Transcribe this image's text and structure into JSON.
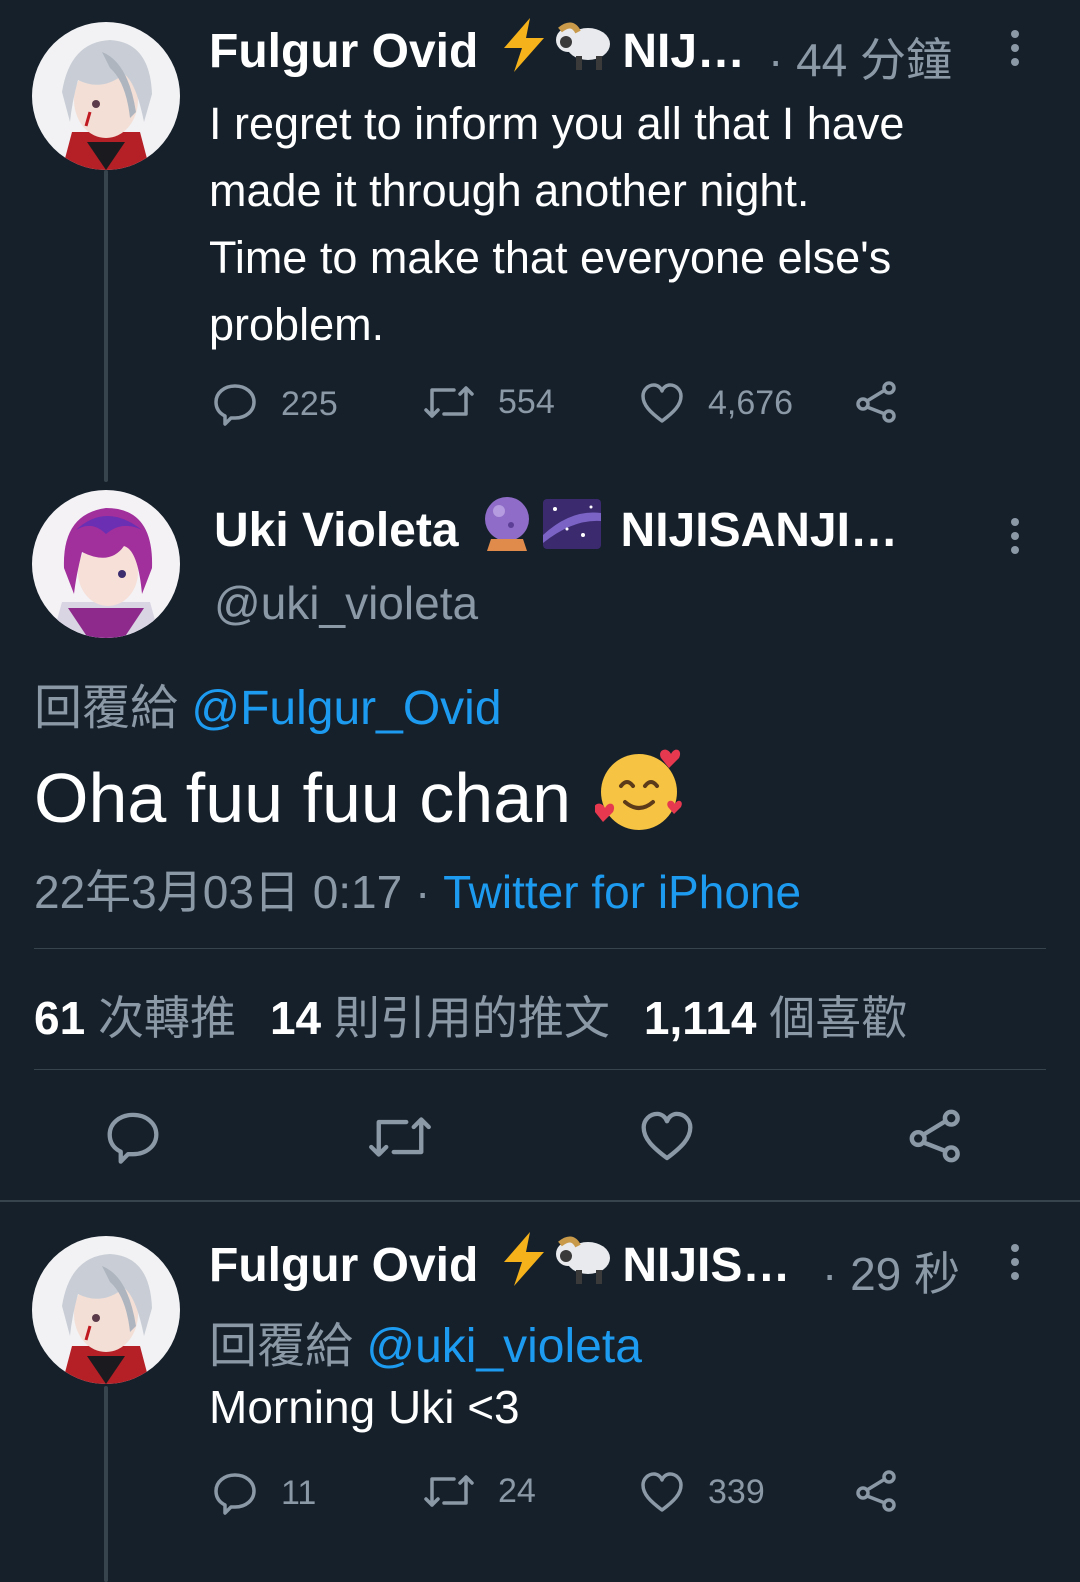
{
  "tweet1": {
    "display_name": "Fulgur Ovid",
    "name_suffix": "NIJ…",
    "time": "· 44 分鐘",
    "text_lines": [
      "I regret to inform you all that I have",
      "made it through another night.",
      "Time to make that everyone else's",
      "problem."
    ],
    "replies": "225",
    "retweets": "554",
    "likes": "4,676"
  },
  "main": {
    "display_name": "Uki Violeta",
    "name_suffix": "NIJISANJI…",
    "handle": "@uki_violeta",
    "reply_prefix": "回覆給",
    "reply_to": "@Fulgur_Ovid",
    "text": "Oha fuu fuu chan",
    "date": "22年3月03日 0:17",
    "sep": "·",
    "source": "Twitter for iPhone",
    "stats": {
      "retweets_count": "61",
      "retweets_label": "次轉推",
      "quotes_count": "14",
      "quotes_label": "則引用的推文",
      "likes_count": "1,114",
      "likes_label": "個喜歡"
    }
  },
  "tweet3": {
    "display_name": "Fulgur Ovid",
    "name_suffix": "NIJIS…",
    "time": "· 29 秒",
    "reply_prefix": "回覆給",
    "reply_to": "@uki_violeta",
    "text": "Morning Uki <3",
    "replies": "11",
    "retweets": "24",
    "likes": "339"
  },
  "colors": {
    "background": "#15202b",
    "muted": "#8b98a5",
    "link": "#1d9bf0",
    "divider": "#38444d"
  },
  "icons": [
    "reply-icon",
    "retweet-icon",
    "like-icon",
    "share-icon",
    "more-icon",
    "lightning-emoji",
    "sheep-emoji",
    "crystal-ball-emoji",
    "milky-way-emoji",
    "smiling-hearts-emoji"
  ]
}
